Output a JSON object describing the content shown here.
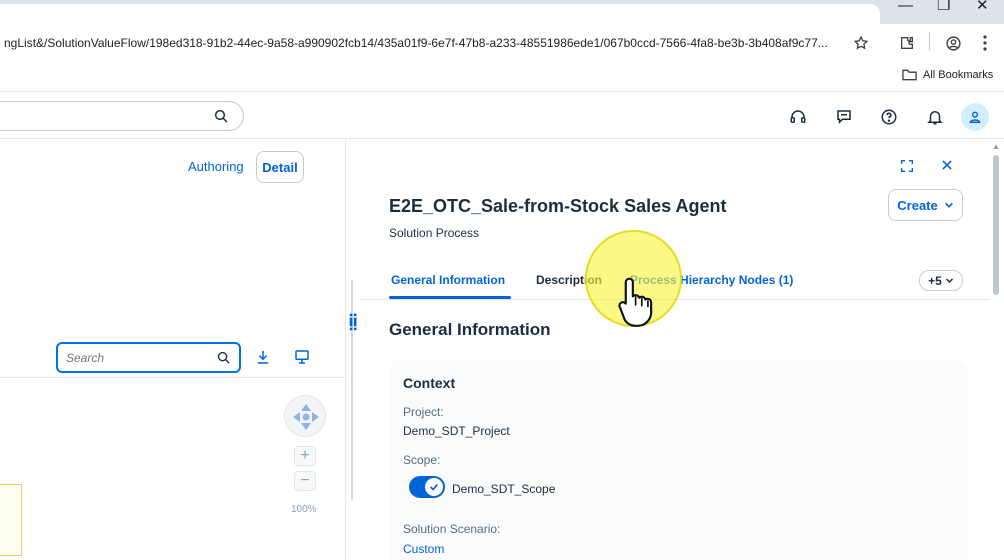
{
  "browser": {
    "url": "ngList&/SolutionValueFlow/198ed318-91b2-44ec-9a58-a990902fcb14/435a01f9-6e7f-47b8-a233-48551986ede1/067b0ccd-7566-4fa8-be3b-3b408af9c77...",
    "bookmarks_label": "All Bookmarks",
    "icons": [
      "star-icon",
      "extension-icon",
      "profile-icon",
      "menu-dots-icon",
      "folder-icon",
      "minimize-icon",
      "restore-icon",
      "close-icon"
    ]
  },
  "shell": {
    "icons": [
      "search-icon",
      "headset-icon",
      "feedback-icon",
      "help-icon",
      "bell-icon",
      "user-icon"
    ]
  },
  "left": {
    "authoring": "Authoring",
    "detail": "Detail",
    "search_placeholder": "Search",
    "zoom_in": "+",
    "zoom_out": "−",
    "zoom": "100%"
  },
  "right": {
    "title": "E2E_OTC_Sale-from-Stock Sales Agent",
    "subtitle": "Solution Process",
    "create": "Create",
    "tabs": [
      {
        "label": "General Information",
        "active": true
      },
      {
        "label": "Description",
        "active": false
      },
      {
        "label": "Process Hierarchy Nodes (1)",
        "active": false
      }
    ],
    "more_tabs": "+5",
    "section_title": "General Information",
    "context": {
      "title": "Context",
      "project_label": "Project:",
      "project_value": "Demo_SDT_Project",
      "scope_label": "Scope:",
      "scope_value": "Demo_SDT_Scope",
      "scenario_label": "Solution Scenario:",
      "scenario_value": "Custom"
    }
  },
  "colors": {
    "accent": "#0064d9",
    "cursor_highlight": "#f8f43c"
  }
}
